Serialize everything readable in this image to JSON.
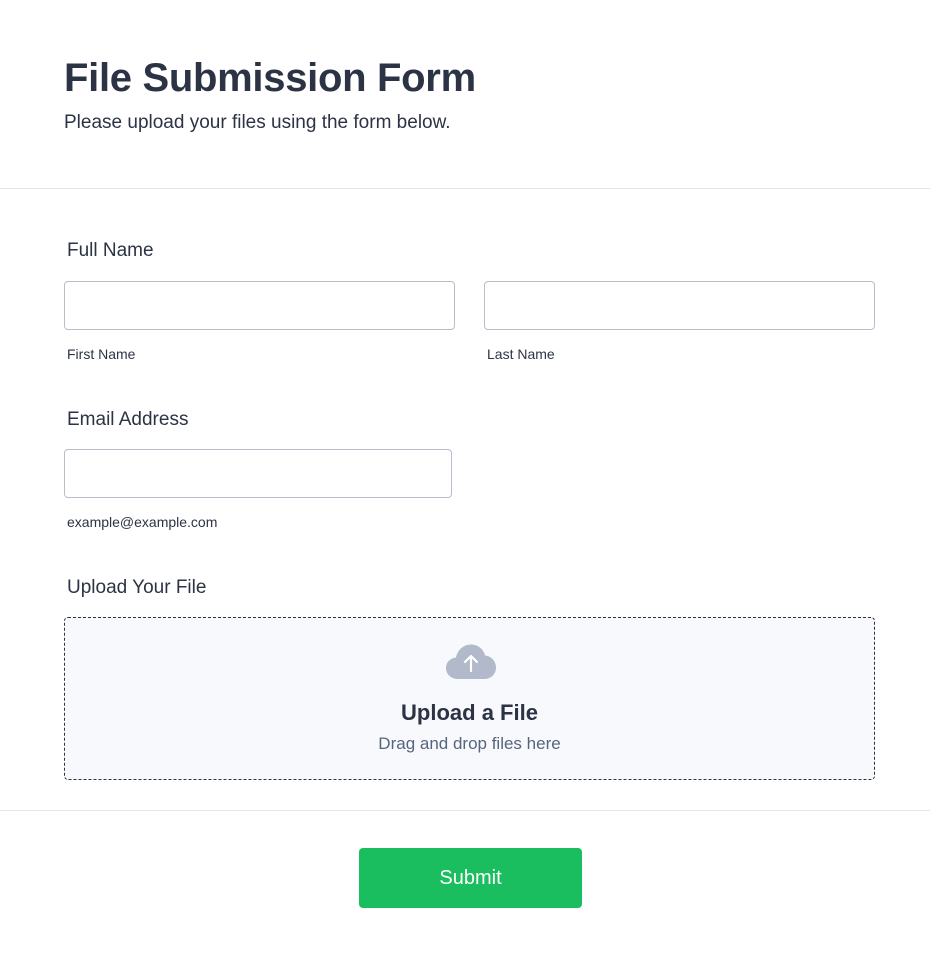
{
  "header": {
    "title": "File Submission Form",
    "subtitle": "Please upload your files using the form below."
  },
  "full_name": {
    "label": "Full Name",
    "first": {
      "value": "",
      "sublabel": "First Name"
    },
    "last": {
      "value": "",
      "sublabel": "Last Name"
    }
  },
  "email": {
    "label": "Email Address",
    "value": "",
    "sublabel": "example@example.com"
  },
  "upload": {
    "label": "Upload Your File",
    "icon": "cloud-upload-icon",
    "title": "Upload a File",
    "hint": "Drag and drop files here"
  },
  "submit": {
    "label": "Submit"
  },
  "colors": {
    "text": "#2c3345",
    "muted": "#57647e",
    "border": "#b8bdc9",
    "dropzone_bg": "#f8f9fd",
    "icon": "#b1b9ca",
    "submit_bg": "#1bbe5e"
  }
}
